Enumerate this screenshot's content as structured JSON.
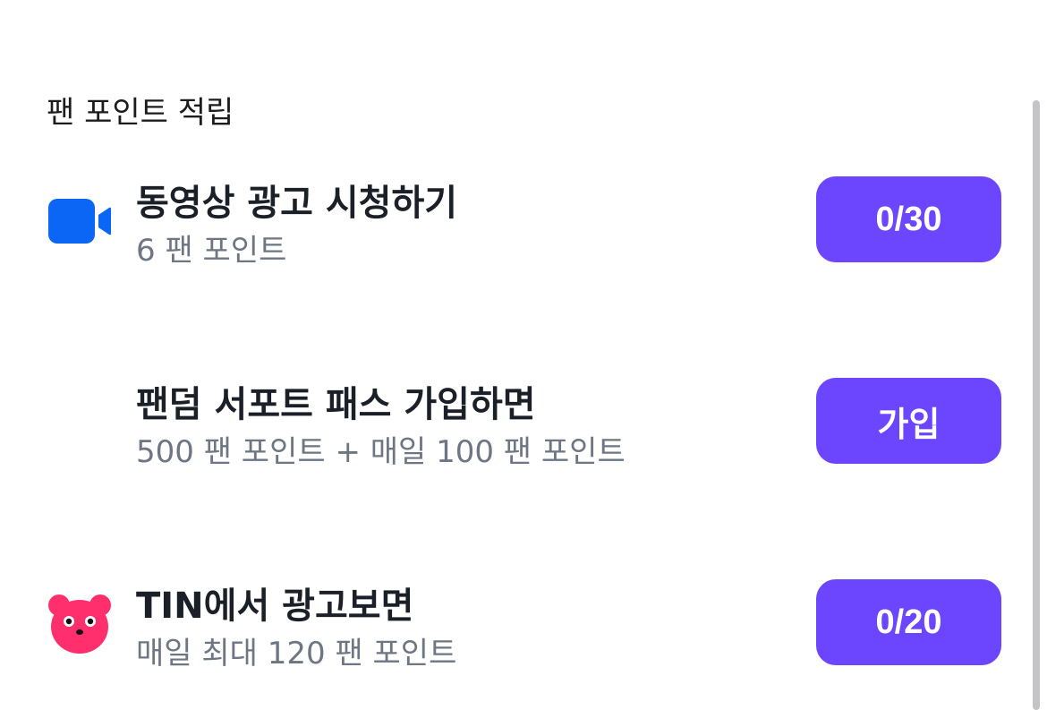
{
  "section": {
    "title": "팬 포인트 적립"
  },
  "rows": [
    {
      "title": "동영상 광고 시청하기",
      "subtitle": "6 팬 포인트",
      "icon": "video-camera-icon",
      "button": "0/30"
    },
    {
      "title": "팬덤 서포트 패스 가입하면",
      "subtitle": "500 팬 포인트 + 매일 100 팬 포인트",
      "icon": "",
      "button": "가입"
    },
    {
      "title": "TIN에서 광고보면",
      "subtitle": "매일 최대 120 팬 포인트",
      "icon": "pink-bear-icon",
      "button": "0/20"
    }
  ],
  "colors": {
    "accent": "#6b45ff",
    "video_icon": "#0b66f5",
    "bear_icon": "#ff2f6d",
    "title_text": "#1b1f27",
    "sub_text": "#6e7583"
  }
}
